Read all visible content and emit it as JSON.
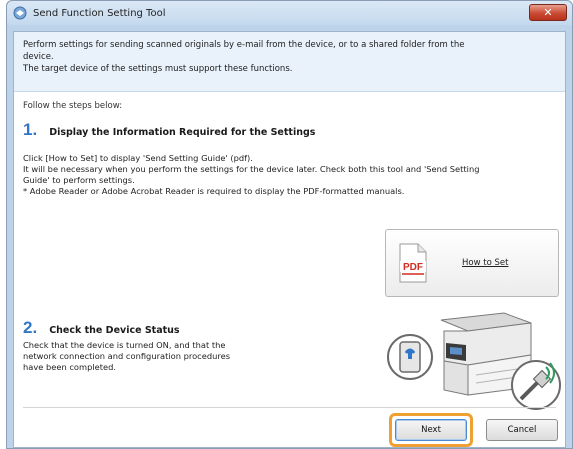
{
  "window": {
    "title": "Send Function Setting Tool",
    "close_glyph": "✕"
  },
  "header": {
    "line1": "Perform settings for sending scanned originals by e-mail from the device, or to a shared folder from the",
    "line2": "device.",
    "line3": "The target device of the settings must support these functions."
  },
  "follow_text": "Follow the steps below:",
  "step1": {
    "number": "1.",
    "title": "Display the Information Required for the Settings",
    "line1": "Click [How to Set] to display 'Send Setting Guide' (pdf).",
    "line2": "It will be necessary when you perform the settings for the device later. Check both this tool and 'Send Setting",
    "line3": "Guide' to perform settings.",
    "line4": "* Adobe Reader or Adobe Acrobat Reader is required to display the PDF-formatted manuals."
  },
  "howto_button": {
    "label": "How to Set",
    "icon_text": "PDF",
    "icon": "pdf-document-icon"
  },
  "step2": {
    "number": "2.",
    "title": "Check the Device Status",
    "line1": "Check that the device is turned ON, and that the",
    "line2": "network connection and configuration procedures",
    "line3": "have been completed."
  },
  "buttons": {
    "next": "Next",
    "cancel": "Cancel"
  },
  "colors": {
    "accent_number": "#2f76c6",
    "header_bg": "#e9f2fb",
    "highlight": "#f0a030",
    "pdf_red": "#d22b20"
  }
}
